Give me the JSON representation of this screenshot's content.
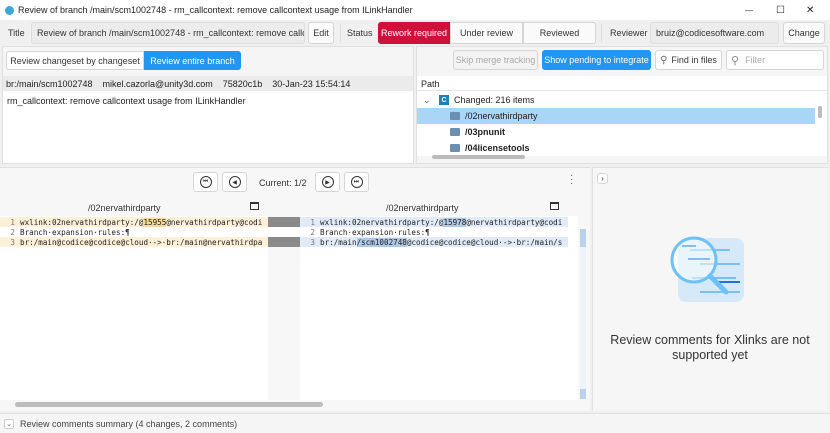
{
  "window": {
    "title": "Review of branch /main/scm1002748 - rm_callcontext: remove callcontext usage from ILinkHandler",
    "minimize": "—",
    "maximize": "☐",
    "close": "✕"
  },
  "header": {
    "title_label": "Title",
    "title_value": "Review of branch /main/scm1002748 - rm_callcontext: remove callcontext usage from ILinkHandler",
    "edit": "Edit",
    "status_label": "Status",
    "statuses": [
      "Rework required",
      "Under review",
      "Reviewed"
    ],
    "reviewer_label": "Reviewer",
    "reviewer_value": "bruiz@codicesoftware.com",
    "change": "Change",
    "accent": "#d0103a"
  },
  "left": {
    "mode_tabs": [
      "Review changeset by changeset",
      "Review entire branch"
    ],
    "info": {
      "branch": "br:/main/scm1002748",
      "author": "mikel.cazorla@unity3d.com",
      "changeset": "75820c1b",
      "date": "30-Jan-23 15:54:14"
    },
    "comment": "rm_callcontext: remove callcontext usage from ILinkHandler"
  },
  "right": {
    "skip": "Skip merge tracking",
    "pending": "Show pending to integrate",
    "find": "Find in files",
    "filter_placeholder": "Filter",
    "path_header": "Path",
    "changed_badge": "C",
    "changed": "Changed: 216 items",
    "items": [
      "/02nervathirdparty",
      "/03pnunit",
      "/04licensetools"
    ]
  },
  "diff": {
    "current": "Current: 1/2",
    "left_title": "/02nervathirdparty",
    "right_title": "/02nervathirdparty",
    "left_lines": [
      {
        "n": "1",
        "pre": "wxlink:02nervathirdparty:/@",
        "hl": "15955",
        "post": "@nervathirdparty@codi"
      },
      {
        "n": "2",
        "pre": "Branch·expansion·rules:¶",
        "hl": "",
        "post": ""
      },
      {
        "n": "3",
        "pre": "br:/main@codice@codice@cloud·->·br:/main@nervathirdpa",
        "hl": "",
        "post": ""
      }
    ],
    "right_lines": [
      {
        "n": "1",
        "pre": "wxlink:02nervathirdparty:/@",
        "hl": "15978",
        "post": "@nervathirdparty@codi"
      },
      {
        "n": "2",
        "pre": "Branch·expansion·rules:¶",
        "hl": "",
        "post": ""
      },
      {
        "n": "3",
        "pre": "br:/main",
        "hl": "/scm1002748",
        "post": "@codice@codice@cloud·->·br:/main/s"
      }
    ]
  },
  "comments": {
    "message": "Review comments for Xlinks are not supported yet",
    "expand": "›"
  },
  "footer": {
    "summary": "Review comments summary (4 changes, 2 comments)"
  }
}
